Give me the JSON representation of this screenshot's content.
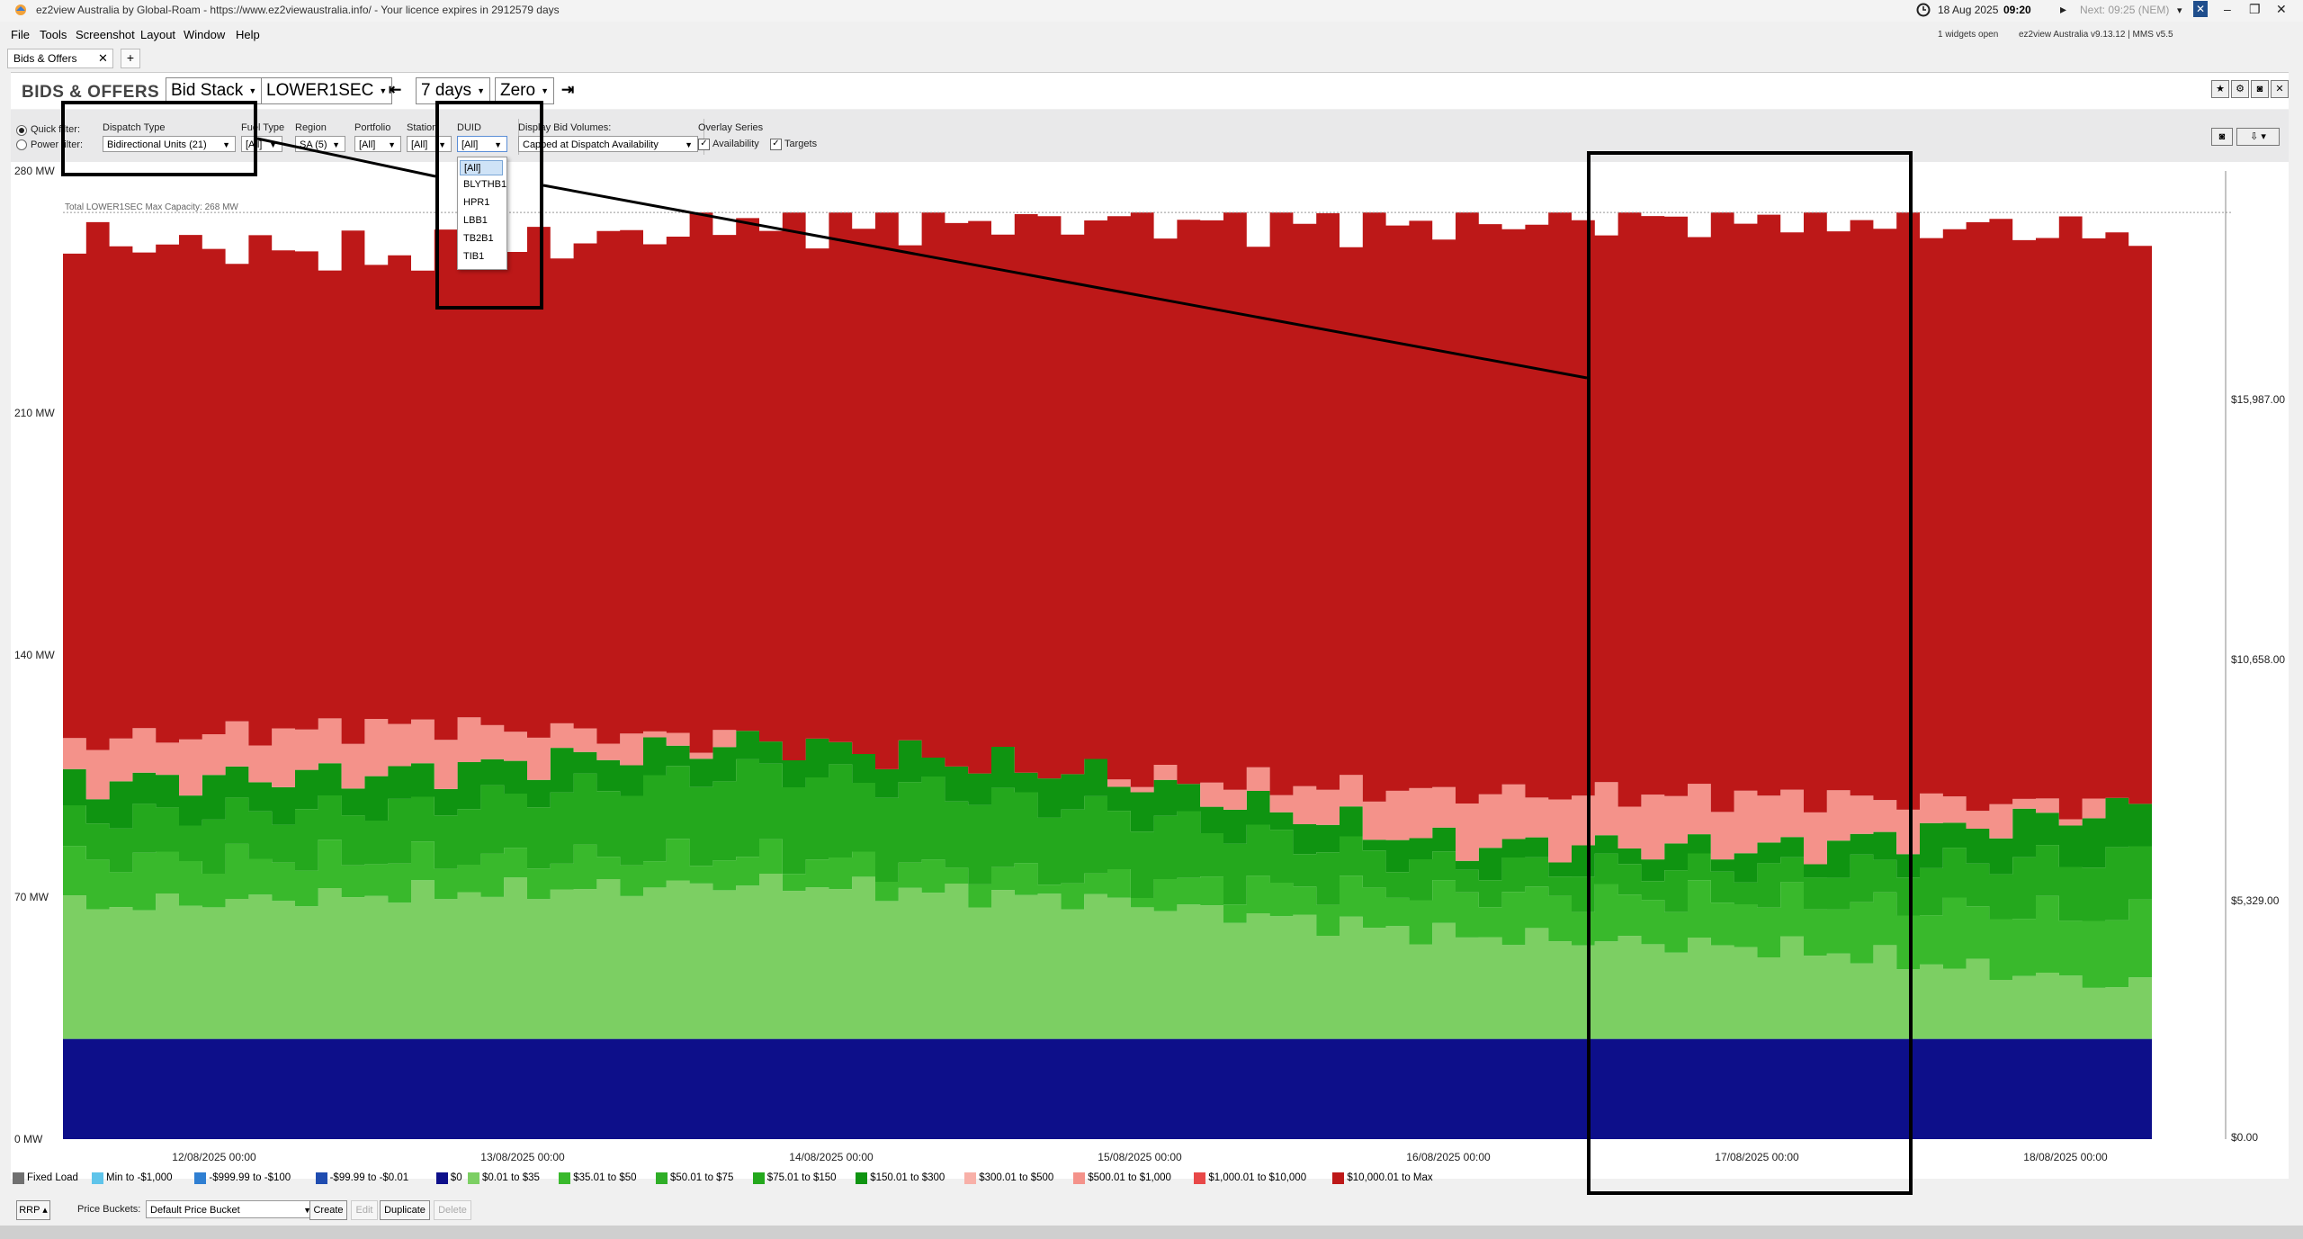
{
  "window": {
    "title": "ez2view Australia by Global-Roam - https://www.ez2viewaustralia.info/ - Your licence expires in 2912579 days",
    "date": "18 Aug 2025",
    "time": "09:20",
    "next": "Next: 09:25 (NEM)",
    "widgets_open": "1 widgets open",
    "version": "ez2view Australia v9.13.12 | MMS v5.5"
  },
  "menu": [
    "File",
    "Tools",
    "Screenshot",
    "Layout",
    "Window",
    "Help"
  ],
  "tab": {
    "label": "Bids & Offers",
    "close": "✕",
    "add": "+"
  },
  "header": {
    "title": "BIDS & OFFERS",
    "view": "Bid Stack",
    "service": "LOWER1SEC",
    "period": "7 days",
    "axis_mode": "Zero"
  },
  "filters": {
    "quick_filter": "Quick filter:",
    "power_filter": "Power filter:",
    "dispatch_type_label": "Dispatch Type",
    "dispatch_type_value": "Bidirectional Units (21)",
    "fuel_type_label": "Fuel Type",
    "fuel_type_value": "[All]",
    "region_label": "Region",
    "region_value": "SA (5)",
    "portfolio_label": "Portfolio",
    "portfolio_value": "[All]",
    "station_label": "Station",
    "station_value": "[All]",
    "duid_label": "DUID",
    "duid_value": "[All]",
    "duid_options": [
      "[All]",
      "BLYTHB1",
      "HPR1",
      "LBB1",
      "TB2B1",
      "TIB1"
    ],
    "display_bid_volumes_label": "Display Bid Volumes:",
    "display_bid_volumes_value": "Capped at Dispatch Availability",
    "overlay_label": "Overlay Series",
    "overlay_availability": "Availability",
    "overlay_targets": "Targets"
  },
  "chart_data": {
    "type": "area",
    "capacity_label": "Total LOWER1SEC Max Capacity: 268 MW",
    "y_left_ticks": [
      "280 MW",
      "210 MW",
      "140 MW",
      "70 MW",
      "0 MW"
    ],
    "y_left_range": [
      0,
      280
    ],
    "y_right_ticks": [
      "$15,987.00",
      "$10,658.00",
      "$5,329.00",
      "$0.00"
    ],
    "x_ticks": [
      "12/08/2025 00:00",
      "13/08/2025 00:00",
      "14/08/2025 00:00",
      "15/08/2025 00:00",
      "16/08/2025 00:00",
      "17/08/2025 00:00",
      "18/08/2025 00:00"
    ],
    "stack_colors": {
      "b0": "#0d0f8a",
      "b1": "#7ccf63",
      "b2": "#39b92c",
      "b3": "#24a81d",
      "b4": "#0f9411",
      "b5": "#f4928a",
      "b6": "#bd1818"
    },
    "series": [
      {
        "name": "$0",
        "values": [
          29,
          29,
          29,
          29,
          29,
          29,
          29
        ]
      },
      {
        "name": "$0.01 to $35",
        "values": [
          38,
          42,
          45,
          40,
          30,
          26,
          15
        ]
      },
      {
        "name": "$35.01 to $50",
        "values": [
          14,
          10,
          8,
          6,
          12,
          14,
          20
        ]
      },
      {
        "name": "$75.01 to $150",
        "values": [
          12,
          15,
          25,
          20,
          8,
          9,
          18
        ]
      },
      {
        "name": "$150.01 to $300",
        "values": [
          10,
          10,
          8,
          10,
          6,
          6,
          14
        ]
      },
      {
        "name": "$500.01 to $1,000",
        "values": [
          12,
          14,
          0,
          0,
          15,
          15,
          0
        ]
      },
      {
        "name": "$10,000.01 to Max",
        "values": [
          145,
          135,
          150,
          160,
          165,
          168,
          165
        ]
      }
    ]
  },
  "legend": [
    {
      "label": "Fixed Load",
      "color": "#707070"
    },
    {
      "label": "Min to -$1,000",
      "color": "#5fc4ea"
    },
    {
      "label": "-$999.99 to -$100",
      "color": "#2f7fd2"
    },
    {
      "label": "-$99.99 to -$0.01",
      "color": "#1f4cb0"
    },
    {
      "label": "$0",
      "color": "#0d0f8a"
    },
    {
      "label": "$0.01 to $35",
      "color": "#7ccf63"
    },
    {
      "label": "$35.01 to $50",
      "color": "#39b92c"
    },
    {
      "label": "$50.01 to $75",
      "color": "#2fae27"
    },
    {
      "label": "$75.01 to $150",
      "color": "#24a81d"
    },
    {
      "label": "$150.01 to $300",
      "color": "#0f9411"
    },
    {
      "label": "$300.01 to $500",
      "color": "#f8b0a8"
    },
    {
      "label": "$500.01 to $1,000",
      "color": "#f4928a"
    },
    {
      "label": "$1,000.01 to $10,000",
      "color": "#e84848"
    },
    {
      "label": "$10,000.01 to Max",
      "color": "#bd1818"
    }
  ],
  "bottom": {
    "rrp": "RRP",
    "price_buckets_label": "Price Buckets:",
    "price_buckets_value": "Default Price Bucket",
    "create": "Create",
    "edit": "Edit",
    "duplicate": "Duplicate",
    "delete": "Delete"
  }
}
